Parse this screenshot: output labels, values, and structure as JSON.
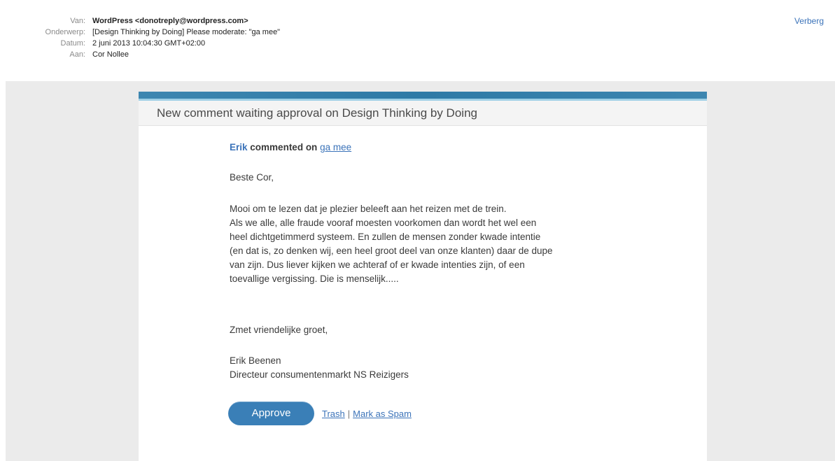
{
  "header": {
    "fields": [
      {
        "label": "Van:",
        "value": "WordPress <donotreply@wordpress.com>"
      },
      {
        "label": "Onderwerp:",
        "value": "[Design Thinking by Doing] Please moderate: \"ga mee\""
      },
      {
        "label": "Datum:",
        "value": "2 juni 2013 10:04:30 GMT+02:00"
      },
      {
        "label": "Aan:",
        "value": "Cor Nollee"
      }
    ],
    "hide_label": "Verberg"
  },
  "email": {
    "title": "New comment waiting approval on Design Thinking by Doing",
    "author": "Erik",
    "commented_on": "commented on",
    "post_link": "ga mee",
    "greeting": "Beste Cor,",
    "body_lines": [
      "Mooi om te lezen dat je plezier beleeft aan het reizen met de trein.",
      "Als we alle, alle fraude vooraf moesten voorkomen dan wordt het wel een",
      "heel dichtgetimmerd systeem. En zullen de mensen zonder kwade intentie",
      "(en dat is, zo denken wij, een heel groot deel van onze klanten) daar de dupe",
      "van zijn. Dus liever kijken we achteraf of er kwade intenties zijn, of een",
      "toevallige vergissing. Die is menselijk....."
    ],
    "closing": "Zmet vriendelijke groet,",
    "signature_name": "Erik Beenen",
    "signature_title": "Directeur consumentenmarkt NS Reizigers",
    "approve_label": "Approve",
    "trash_label": "Trash",
    "separator": "|",
    "spam_label": "Mark as Spam"
  }
}
